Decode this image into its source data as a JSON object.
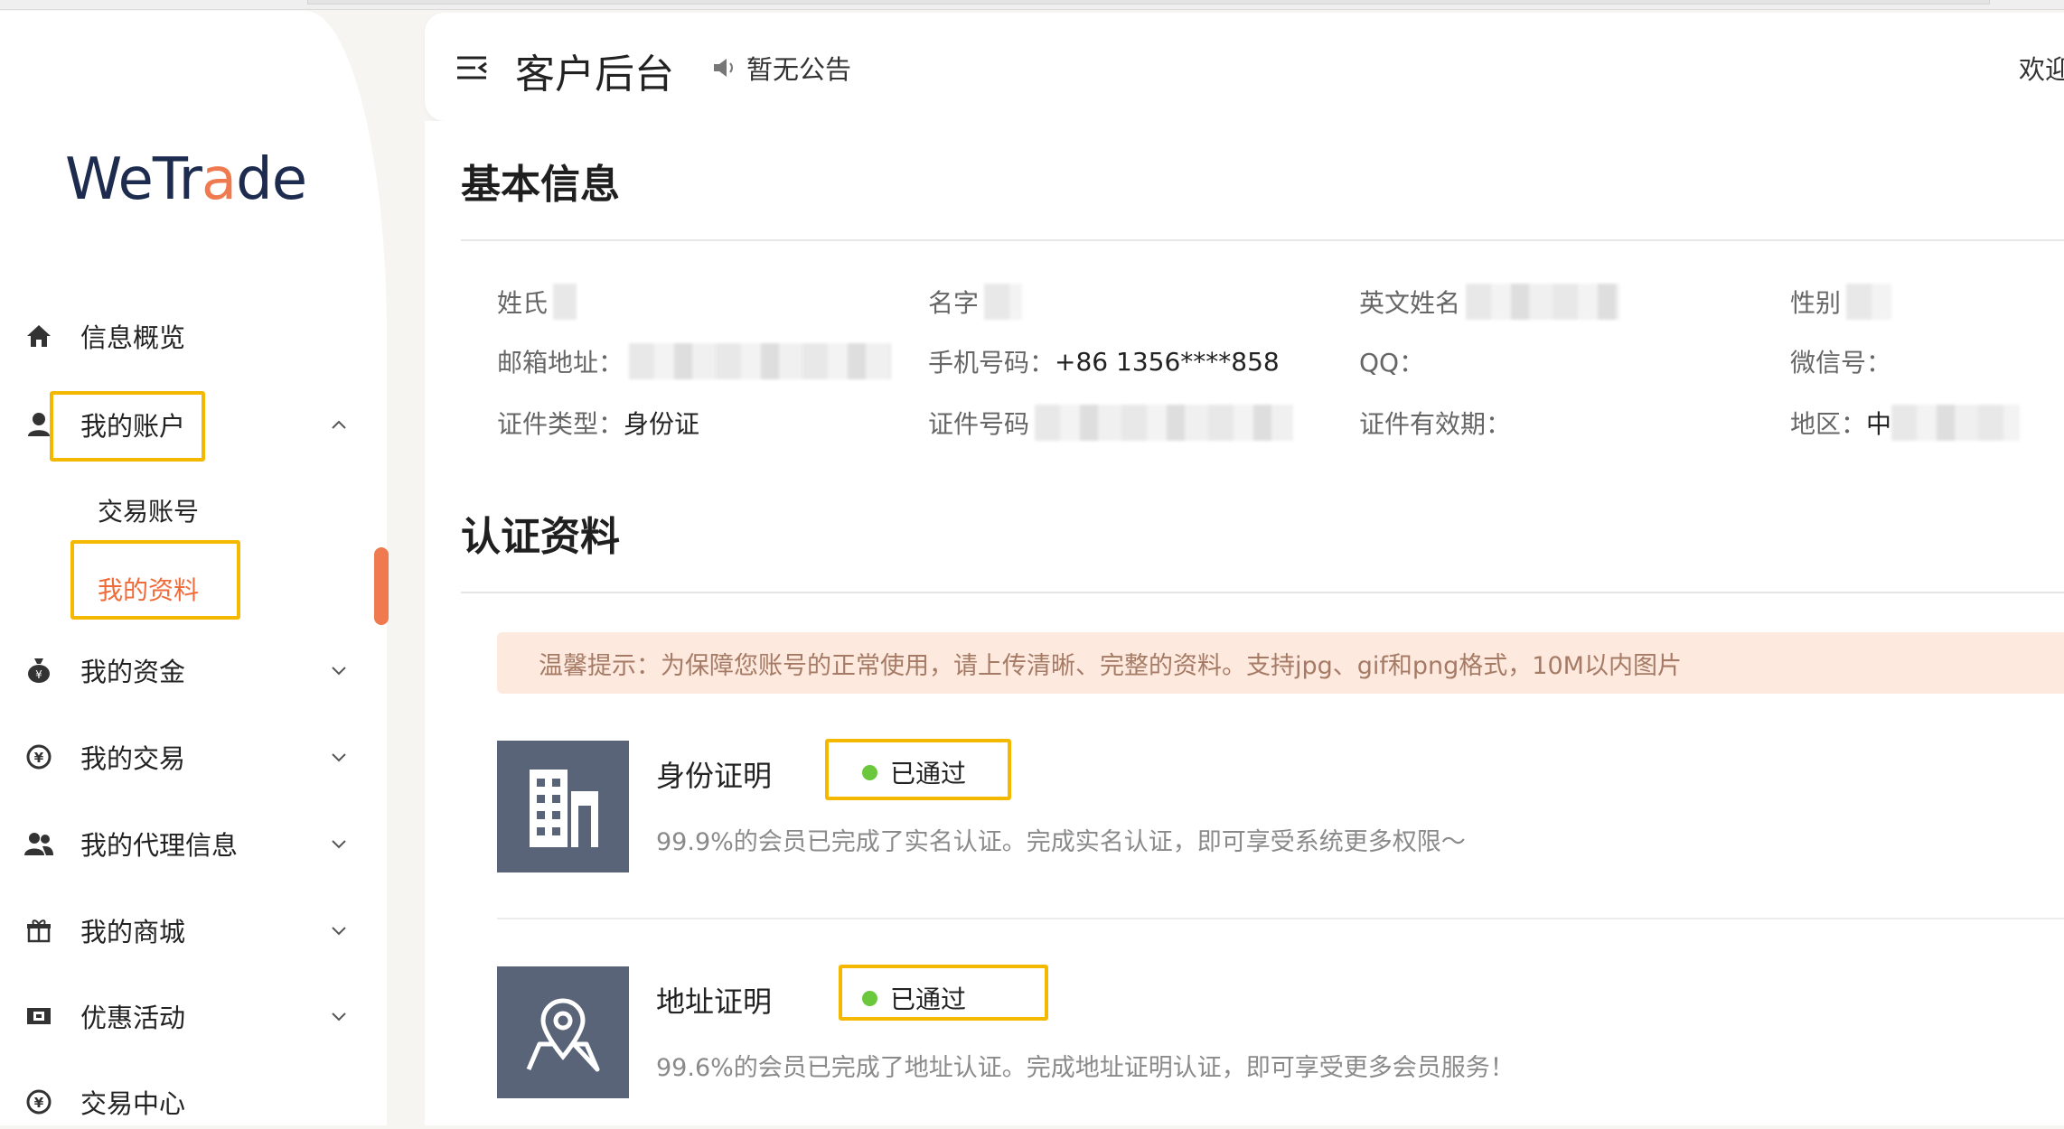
{
  "brand": {
    "logo_part1": "WeTr",
    "logo_accent": "a",
    "logo_part2": "de"
  },
  "header": {
    "title": "客户后台",
    "announcement": "暂无公告",
    "welcome": "欢迎"
  },
  "sidebar": {
    "items": [
      {
        "label": "信息概览",
        "icon": "home-icon"
      },
      {
        "label": "我的账户",
        "icon": "user-icon",
        "expanded": true,
        "children": [
          {
            "label": "交易账号"
          },
          {
            "label": "我的资料",
            "active": true
          }
        ]
      },
      {
        "label": "我的资金",
        "icon": "money-bag-icon"
      },
      {
        "label": "我的交易",
        "icon": "currency-exchange-icon"
      },
      {
        "label": "我的代理信息",
        "icon": "users-icon"
      },
      {
        "label": "我的商城",
        "icon": "gift-icon"
      },
      {
        "label": "优惠活动",
        "icon": "ticket-icon"
      },
      {
        "label": "交易中心",
        "icon": "currency-exchange-icon"
      }
    ]
  },
  "basic_info": {
    "title": "基本信息",
    "fields": [
      {
        "label": "姓氏",
        "value": ""
      },
      {
        "label": "名字",
        "value": ""
      },
      {
        "label": "英文姓名",
        "value": ""
      },
      {
        "label": "性别",
        "value": ""
      },
      {
        "label": "邮箱地址：",
        "value": ""
      },
      {
        "label": "手机号码：",
        "value": "+86 1356****858"
      },
      {
        "label": "QQ：",
        "value": ""
      },
      {
        "label": "微信号：",
        "value": ""
      },
      {
        "label": "证件类型：",
        "value": "身份证"
      },
      {
        "label": "证件号码",
        "value": ""
      },
      {
        "label": "证件有效期：",
        "value": ""
      },
      {
        "label": "地区：",
        "value": "中"
      }
    ]
  },
  "certification": {
    "title": "认证资料",
    "notice": "温馨提示：为保障您账号的正常使用，请上传清晰、完整的资料。支持jpg、gif和png格式，10M以内图片",
    "items": [
      {
        "title": "身份证明",
        "status": "已通过",
        "icon": "building-icon",
        "description": "99.9%的会员已完成了实名认证。完成实名认证，即可享受系统更多权限～"
      },
      {
        "title": "地址证明",
        "status": "已通过",
        "icon": "location-map-icon",
        "description": "99.6%的会员已完成了地址认证。完成地址证明认证，即可享受更多会员服务！"
      }
    ]
  },
  "colors": {
    "accent": "#ef7a50",
    "highlight": "#f5b800",
    "status_ok": "#6bc83c",
    "icon_bg": "#5a6478"
  }
}
